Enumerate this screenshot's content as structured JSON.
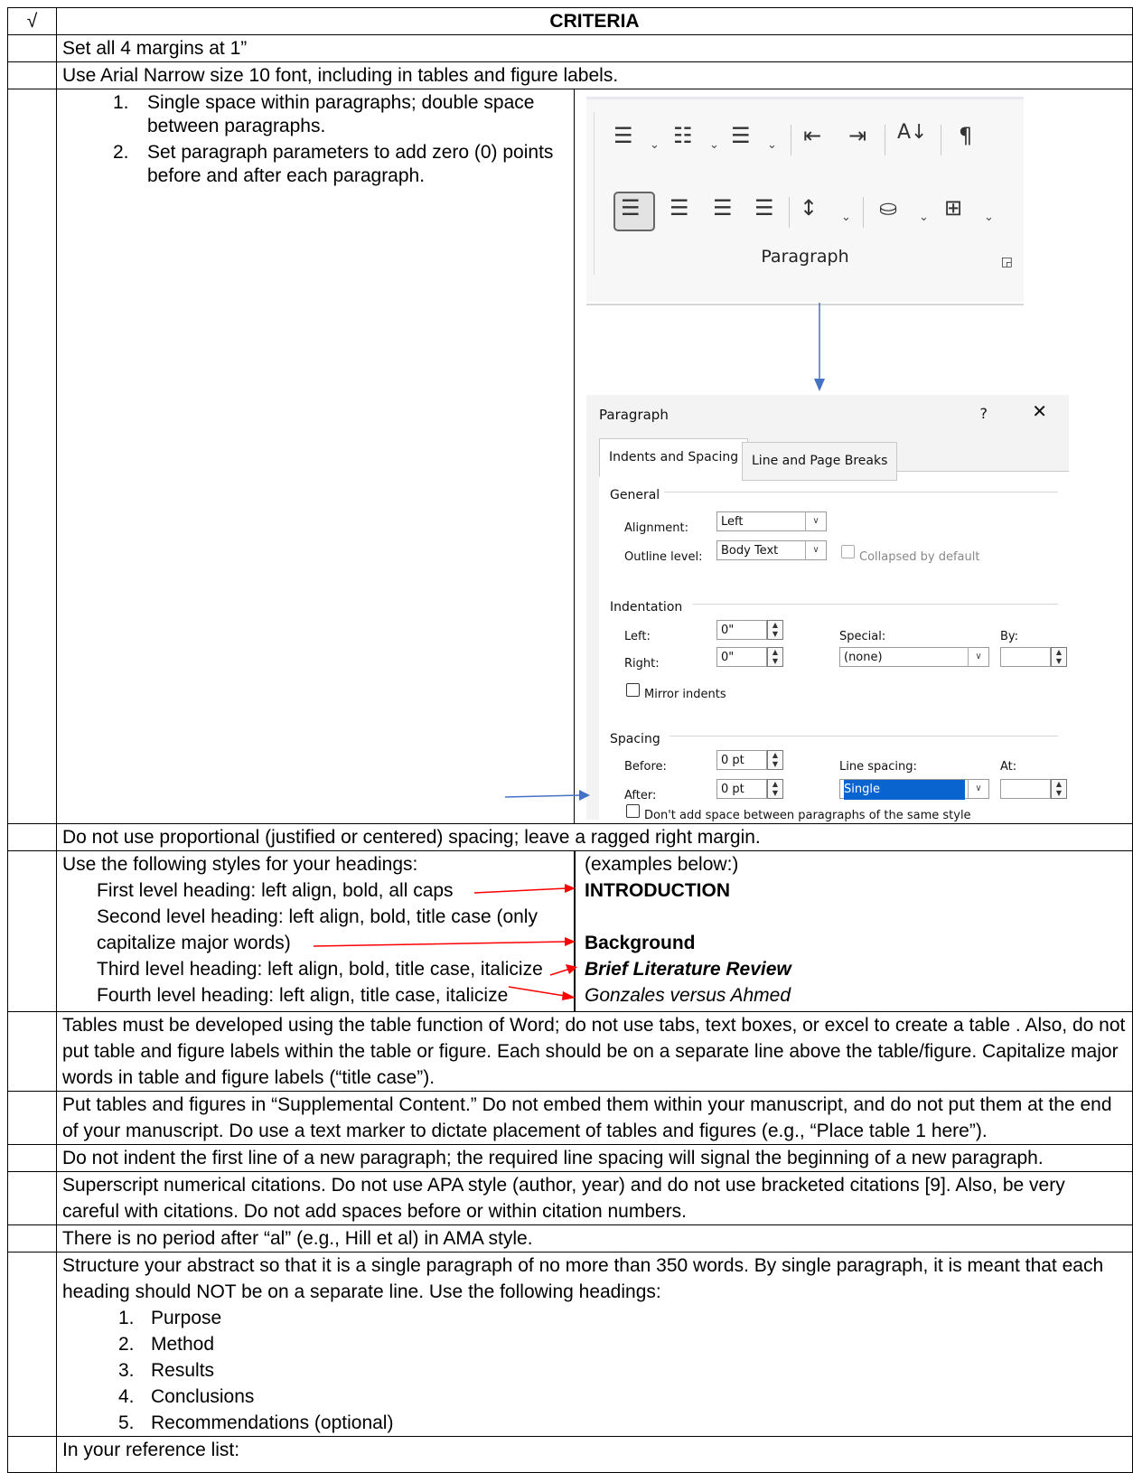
{
  "header": {
    "check_symbol": "√",
    "criteria_label": "CRITERIA"
  },
  "rows": {
    "margins": "Set all 4 margins at 1”",
    "font": "Use Arial Narrow size 10 font, including in tables and figure labels.",
    "spacing_items": [
      {
        "num": "1.",
        "text": "Single space within paragraphs; double space between paragraphs."
      },
      {
        "num": "2.",
        "text": "Set paragraph parameters to add zero (0) points before and after each paragraph."
      }
    ],
    "ragged": "Do not use proportional (justified or centered) spacing; leave a ragged right margin.",
    "headings_intro": "Use the following styles for your headings:",
    "headings": [
      "First level heading: left align, bold, all caps",
      "Second level heading: left align, bold, title case (only capitalize major words)",
      "Third level heading: left align, bold, title case, italicize",
      "Fourth level heading: left align, title case, italicize"
    ],
    "examples_label": "(examples below:)",
    "examples": [
      "INTRODUCTION",
      "Background",
      "Brief Literature Review",
      "Gonzales versus Ahmed"
    ],
    "tables": "Tables must be developed using the table function of Word; do not use tabs, text boxes, or excel to create a table . Also, do not put table and figure labels within the table or figure. Each should be on a separate line above the table/figure. Capitalize major words in table and figure labels (“title case”).",
    "supplemental": "Put tables and figures in “Supplemental Content.” Do not embed them within your manuscript, and do not put them at the end of your manuscript. Do use a text marker to dictate placement of tables and figures (e.g., “Place table 1 here”).",
    "indent": "Do not indent the first line of a new paragraph; the required line spacing will signal the beginning of a new paragraph.",
    "citations": "Superscript numerical citations. Do not use APA style (author, year) and do not use bracketed citations [9]. Also, be very careful with citations. Do not add spaces before or within citation numbers.",
    "al": "There is no period after “al” (e.g., Hill et al) in AMA style.",
    "abstract": "Structure your abstract so that it is a single paragraph of no more than 350 words. By single paragraph, it is meant that each heading should NOT be on a separate line. Use the following headings:",
    "abstract_items": [
      {
        "num": "1.",
        "text": "Purpose"
      },
      {
        "num": "2.",
        "text": "Method"
      },
      {
        "num": "3.",
        "text": "Results"
      },
      {
        "num": "4.",
        "text": "Conclusions"
      },
      {
        "num": "5.",
        "text": "Recommendations (optional)"
      }
    ],
    "reference": "In your reference list:"
  },
  "ribbon": {
    "group_label": "Paragraph"
  },
  "dialog": {
    "title": "Paragraph",
    "help": "?",
    "close": "✕",
    "tabs": [
      "Indents and Spacing",
      "Line and Page Breaks"
    ],
    "general": "General",
    "alignment_label": "Alignment:",
    "alignment_value": "Left",
    "outline_label": "Outline level:",
    "outline_value": "Body Text",
    "collapsed_label": "Collapsed by default",
    "indentation": "Indentation",
    "left_label": "Left:",
    "left_value": "0\"",
    "right_label": "Right:",
    "right_value": "0\"",
    "special_label": "Special:",
    "special_value": "(none)",
    "by_label": "By:",
    "mirror_label": "Mirror indents",
    "spacing": "Spacing",
    "before_label": "Before:",
    "before_value": "0 pt",
    "after_label": "After:",
    "after_value": "0 pt",
    "line_spacing_label": "Line spacing:",
    "line_spacing_value": "Single",
    "at_label": "At:",
    "dont_add_label": "Don't add space between paragraphs of the same style"
  },
  "colors": {
    "blue_arrow": "#4472c4",
    "red_arrow": "#ff0000",
    "selection": "#0a64d0"
  }
}
